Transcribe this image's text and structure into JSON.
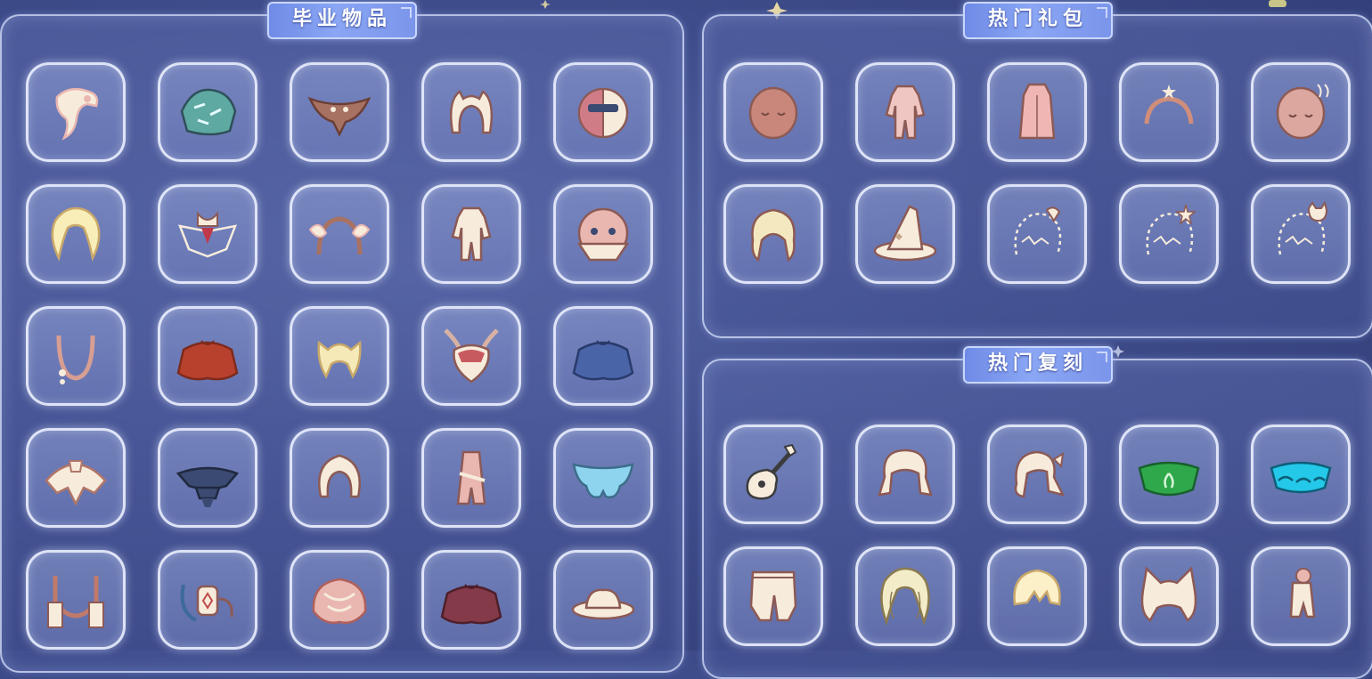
{
  "panels": {
    "graduation": {
      "title": "毕业物品",
      "items": [
        "pink-feather-hair-icon",
        "teal-cape-icon",
        "brown-wing-cape-icon",
        "horned-headband-icon",
        "half-mask-icon",
        "long-wavy-hair-icon",
        "jeweled-collar-icon",
        "wing-headband-icon",
        "armored-outfit-icon",
        "bandana-mask-icon",
        "pink-necklace-icon",
        "red-cape-icon",
        "pigtail-hair-icon",
        "owl-mask-icon",
        "blue-cape-icon",
        "white-cape-icon",
        "dark-layered-cape-icon",
        "bob-hair-icon",
        "ribbon-outfit-icon",
        "blue-butterfly-cape-icon",
        "strap-harness-icon",
        "lantern-prop-icon",
        "shell-cape-icon",
        "maroon-cape-icon",
        "cowboy-hat-icon"
      ]
    },
    "gift": {
      "title": "热门礼包",
      "items": [
        "sleepy-mask-icon",
        "pink-outfit-icon",
        "pink-robe-icon",
        "moon-star-headband-icon",
        "moon-face-mask-icon",
        "curly-hair-icon",
        "witch-hat-icon",
        "shell-hair-accessory-icon",
        "star-hair-accessory-icon",
        "cat-hair-accessory-icon"
      ]
    },
    "rerun": {
      "title": "热门复刻",
      "items": [
        "ukulele-icon",
        "twin-tail-hair-icon",
        "side-ponytail-icon",
        "green-cape-icon",
        "cyan-cape-icon",
        "baggy-pants-icon",
        "wavy-long-hair-icon",
        "short-hair-icon",
        "cat-ear-hood-icon",
        "small-outfit-icon"
      ]
    }
  },
  "colors": {
    "background": "#3f4d8c",
    "panel_border": "#dce6ff",
    "banner": "#8aa6f4",
    "cream": "#f7ecdc",
    "outline": "#8c5a55",
    "pink": "#e9b6b0",
    "brown": "#a87263",
    "red": "#b8412e",
    "blue": "#4a64a8",
    "navy": "#3b4a72",
    "teal": "#5ea9a2",
    "green": "#2fa84c",
    "cyan": "#24c8e8",
    "maroon": "#843a48"
  }
}
